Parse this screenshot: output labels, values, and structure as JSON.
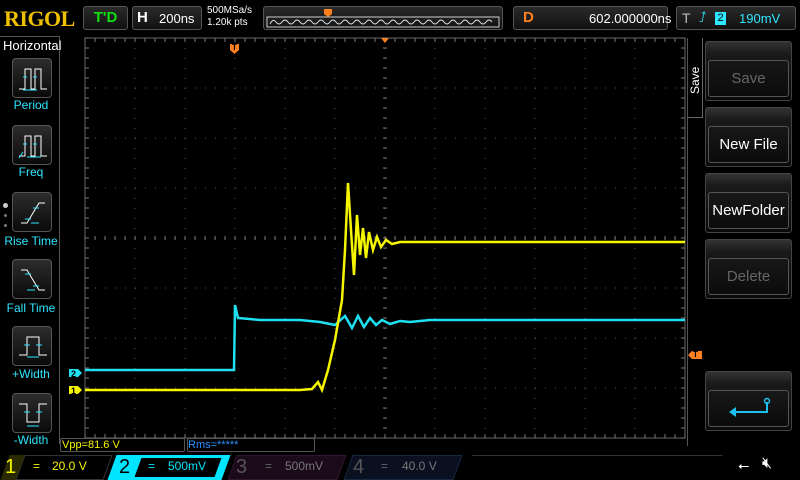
{
  "header": {
    "brand": "RIGOL",
    "run_status": "T'D",
    "timebase_label": "H",
    "timebase": "200ns",
    "sample_rate": "500MSa/s",
    "memory_depth": "1.20k pts",
    "delay_label": "D",
    "delay": "602.000000ns",
    "trigger_label": "T",
    "trigger_source": "2",
    "trigger_level": "190mV"
  },
  "left_menu": {
    "title": "Horizontal",
    "items": [
      {
        "label": "Period"
      },
      {
        "label": "Freq"
      },
      {
        "label": "Rise Time"
      },
      {
        "label": "Fall Time"
      },
      {
        "label": "+Width"
      },
      {
        "label": "-Width"
      }
    ]
  },
  "right_menu": {
    "title": "Save",
    "items": [
      {
        "label": "Save",
        "enabled": false
      },
      {
        "label": "New File",
        "enabled": true
      },
      {
        "label": "NewFolder",
        "enabled": true
      },
      {
        "label": "Delete",
        "enabled": false
      }
    ]
  },
  "markers": {
    "ch1": "1",
    "ch2": "2",
    "trigger": "T"
  },
  "measurements": {
    "vpp": "Vpp=81.6 V",
    "rms": "Rms=*****"
  },
  "channels": [
    {
      "num": "1",
      "coupling": "=",
      "scale": "20.0 V",
      "color": "#f5f500"
    },
    {
      "num": "2",
      "coupling": "=",
      "scale": "500mV",
      "color": "#00e5ff"
    },
    {
      "num": "3",
      "coupling": "=",
      "scale": "500mV",
      "color": "#d040d0"
    },
    {
      "num": "4",
      "coupling": "=",
      "scale": "40.0 V",
      "color": "#3070e0"
    }
  ]
}
